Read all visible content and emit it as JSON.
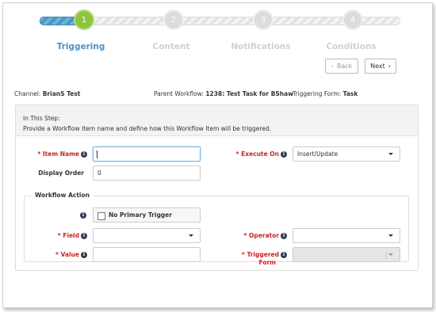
{
  "stepper": {
    "steps": [
      {
        "number": "1",
        "label": "Triggering"
      },
      {
        "number": "2",
        "label": "Content"
      },
      {
        "number": "3",
        "label": "Notifications"
      },
      {
        "number": "4",
        "label": "Conditions"
      }
    ],
    "active_index": 0,
    "back_label": "Back",
    "next_label": "Next"
  },
  "info": {
    "channel_label": "Channel:",
    "channel_value": "BrianS Test",
    "parent_label": "Parent Workflow:",
    "parent_value": "1238: Test Task for BShaw",
    "form_label": "Triggering Form:",
    "form_value": "Task"
  },
  "panel": {
    "step_title": "In This Step:",
    "step_desc": "Provide a Workflow Item name and define how this Workflow Item will be triggered."
  },
  "form": {
    "item_name_label": "* Item Name",
    "item_name_value": "",
    "execute_on_label": "* Execute On",
    "execute_on_value": "Insert/Update",
    "display_order_label": "Display Order",
    "display_order_value": "0"
  },
  "workflow_action": {
    "legend": "Workflow Action",
    "no_primary_trigger_label": "No Primary Trigger",
    "field_label": "* Field",
    "field_value": "",
    "operator_label": "* Operator",
    "operator_value": "",
    "value_label": "* Value",
    "value_value": "",
    "triggered_form_label_line1": "* Triggered",
    "triggered_form_label_line2": "Form",
    "triggered_form_value": ""
  },
  "icons": {
    "info": "info-icon",
    "back": "chevron-left-icon",
    "next": "chevron-right-icon",
    "dropdown": "chevron-down-icon"
  },
  "colors": {
    "active_step": "#8cc63f",
    "active_label": "#4a90c8",
    "required": "#cc2222"
  }
}
